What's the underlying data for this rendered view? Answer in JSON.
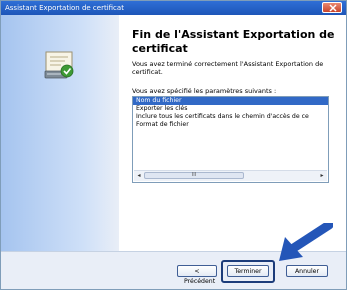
{
  "window": {
    "title": "Assistant Exportation de certificat"
  },
  "main": {
    "heading": "Fin de l'Assistant Exportation de certificat",
    "description1": "Vous avez terminé correctement l'Assistant Exportation de certificat.",
    "description2": "Vous avez spécifié les paramètres suivants :",
    "settings": [
      "Nom du fichier",
      "Exporter les clés",
      "Inclure tous les certificats dans le chemin d'accès de ce",
      "Format de fichier"
    ],
    "scroll_thumb_grip": "III"
  },
  "buttons": {
    "previous": "< Précédent",
    "finish": "Terminer",
    "cancel": "Annuler"
  },
  "icons": {
    "close": "close-icon",
    "certificate": "certificate-icon",
    "pointer": "arrow-icon"
  },
  "colors": {
    "titlebar": "#2f6fd6",
    "selection": "#3169c6",
    "left_panel": "#a5c4ef",
    "highlight_box": "#1c3c7a",
    "arrow": "#2456b8"
  }
}
